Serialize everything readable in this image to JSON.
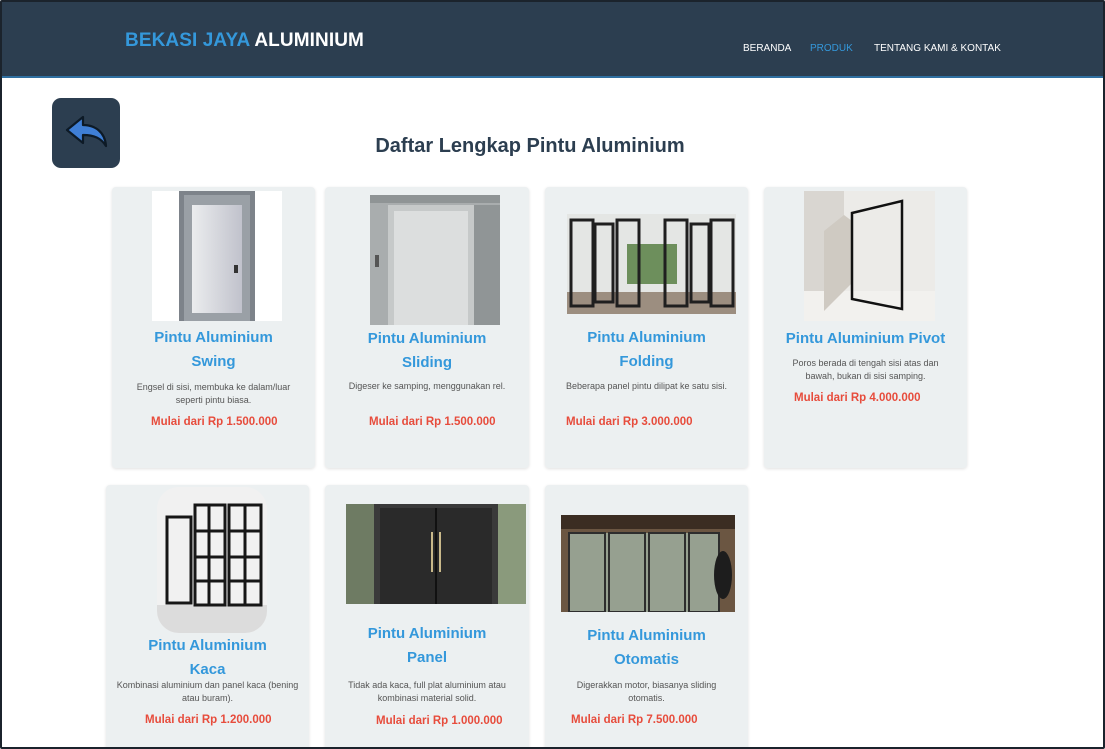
{
  "brand": {
    "accent": "BEKASI JAYA",
    "rest": "ALUMINIUM"
  },
  "nav": {
    "beranda": "BERANDA",
    "produk": "PRODUK",
    "tentang": "TENTANG KAMI & KONTAK"
  },
  "page_title": "Daftar Lengkap Pintu Aluminium",
  "products": [
    {
      "name": "Pintu Aluminium Swing",
      "desc": "Engsel di sisi, membuka ke dalam/luar seperti pintu biasa.",
      "price": "Mulai dari Rp 1.500.000"
    },
    {
      "name": "Pintu Aluminium Sliding",
      "desc": "Digeser ke samping, menggunakan rel.",
      "price": "Mulai dari Rp 1.500.000"
    },
    {
      "name": "Pintu Aluminium Folding",
      "desc": "Beberapa panel pintu dilipat ke satu sisi.",
      "price": "Mulai dari Rp 3.000.000"
    },
    {
      "name": "Pintu Aluminium Pivot",
      "desc": "Poros berada di tengah sisi atas dan bawah, bukan di sisi samping.",
      "price": "Mulai dari Rp 4.000.000"
    },
    {
      "name": "Pintu Aluminium Kaca",
      "desc": "Kombinasi aluminium dan panel kaca (bening atau buram).",
      "price": "Mulai dari Rp 1.200.000"
    },
    {
      "name": "Pintu Aluminium Panel",
      "desc": "Tidak ada kaca, full plat aluminium atau kombinasi material solid.",
      "price": "Mulai dari Rp 1.000.000"
    },
    {
      "name": "Pintu Aluminium Otomatis",
      "desc": "Digerakkan motor, biasanya sliding otomatis.",
      "price": "Mulai dari Rp 7.500.000"
    }
  ],
  "colors": {
    "header": "#2c3e50",
    "accent": "#3498db",
    "price": "#e74c3c",
    "card": "#ecf0f1"
  }
}
